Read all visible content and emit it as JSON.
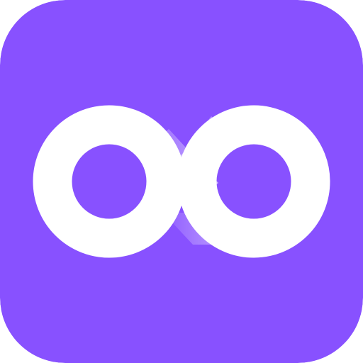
{
  "app_icon": {
    "logo": "infinity-icon",
    "colors": {
      "background": "#8851FF",
      "loop": "#FFFFFF",
      "gradient_fade": "#B08CFF"
    }
  }
}
